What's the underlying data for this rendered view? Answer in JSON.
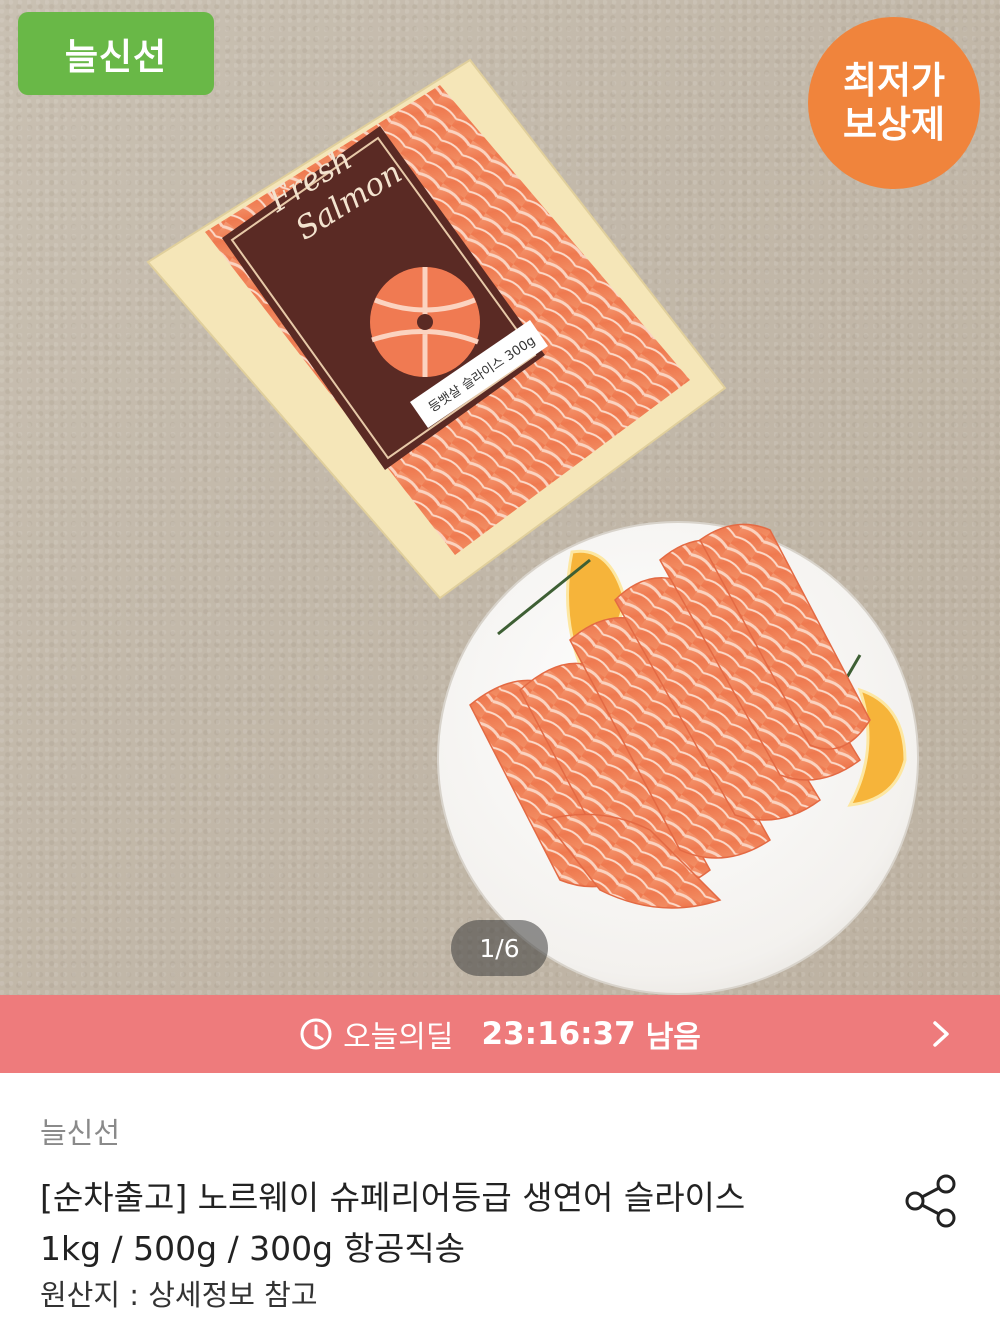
{
  "hero": {
    "brand_tag": "늘신선",
    "badge_line1": "최저가",
    "badge_line2": "보상제",
    "package_text_line1": "Fresh",
    "package_text_line2": "Salmon",
    "package_label": "등뱃살 슬라이스 300g",
    "page_indicator": "1/6"
  },
  "deal": {
    "label": "오늘의딜",
    "time": "23:16:37",
    "suffix": "남음"
  },
  "product": {
    "seller": "늘신선",
    "title_line1": "[순차출고] 노르웨이 슈페리어등급 생연어 슬라이스",
    "title_line2": "1kg / 500g / 300g 항공직송",
    "origin": "원산지 : 상세정보 참고"
  },
  "icons": {
    "clock": "clock-icon",
    "chevron": "chevron-right-icon",
    "share": "share-icon"
  },
  "colors": {
    "brand_green": "#69b847",
    "badge_orange": "#f0843c",
    "deal_pink": "#ee7b7c",
    "salmon": "#f07a52"
  }
}
